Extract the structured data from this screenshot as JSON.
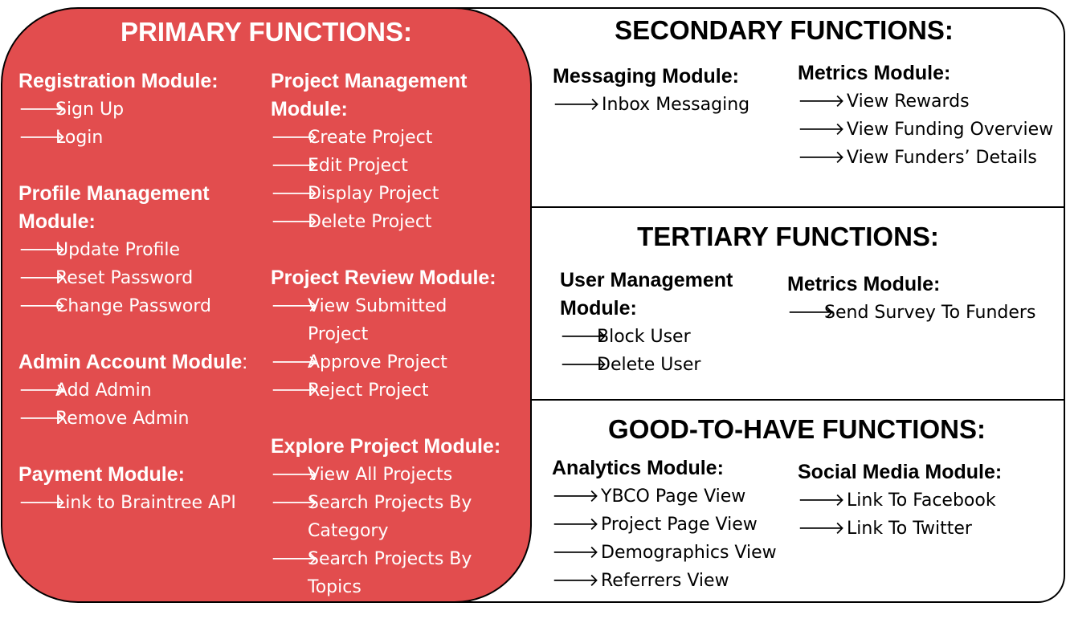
{
  "arrow": "🡒",
  "primary": {
    "title": "PRIMARY FUNCTIONS:",
    "left_modules": [
      {
        "title": "Registration Module:",
        "items": [
          "Sign Up",
          "Login"
        ]
      },
      {
        "title": "Profile Management Module:",
        "title_lines": [
          "Profile Management",
          "Module:"
        ],
        "items": [
          "Update Profile",
          "Reset Password",
          "Change Password"
        ]
      },
      {
        "title": "Admin Account Module",
        "suffix": ":",
        "items": [
          "Add Admin",
          "Remove Admin"
        ]
      },
      {
        "title": "Payment Module:",
        "items": [
          "Link to Braintree API"
        ]
      }
    ],
    "right_modules": [
      {
        "title_lines": [
          "Project Management",
          "Module:"
        ],
        "items": [
          "Create Project",
          "Edit Project",
          "Display Project",
          "Delete Project"
        ]
      },
      {
        "title": "Project Review Module:",
        "items": [
          [
            "View Submitted",
            "Project"
          ],
          "Approve Project",
          "Reject Project"
        ]
      },
      {
        "title": "Explore Project Module:",
        "items": [
          "View All Projects",
          [
            "Search Projects By",
            "Category"
          ],
          [
            "Search Projects By",
            "Topics"
          ]
        ]
      }
    ]
  },
  "secondary": {
    "title": "SECONDARY FUNCTIONS:",
    "modules": [
      {
        "title": "Messaging Module:",
        "items": [
          "Inbox Messaging"
        ]
      },
      {
        "title": "Metrics Module:",
        "items": [
          "View Rewards",
          "View Funding Overview",
          "View Funders’ Details"
        ]
      }
    ]
  },
  "tertiary": {
    "title": "TERTIARY FUNCTIONS:",
    "modules": [
      {
        "title_lines": [
          "User Management",
          "Module:"
        ],
        "items": [
          "Block User",
          "Delete User"
        ]
      },
      {
        "title": "Metrics Module:",
        "items": [
          "Send Survey To Funders"
        ]
      }
    ]
  },
  "good_to_have": {
    "title": "GOOD-TO-HAVE FUNCTIONS:",
    "modules": [
      {
        "title": "Analytics Module:",
        "items": [
          "YBCO Page View",
          "Project Page View",
          "Demographics View",
          "Referrers View"
        ]
      },
      {
        "title": "Social Media Module:",
        "items": [
          "Link To Facebook",
          "Link To Twitter"
        ]
      }
    ]
  }
}
